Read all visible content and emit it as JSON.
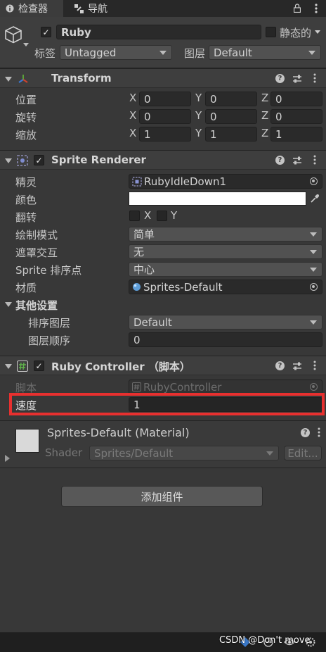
{
  "tabs": [
    {
      "label": "检查器",
      "icon": "info-icon"
    },
    {
      "label": "导航",
      "icon": "navigation-icon"
    }
  ],
  "header": {
    "name": "Ruby",
    "static_label": "静态的",
    "tag_label": "标签",
    "tag_value": "Untagged",
    "layer_label": "图层",
    "layer_value": "Default"
  },
  "transform": {
    "title": "Transform",
    "rows": [
      {
        "label": "位置",
        "x": "0",
        "y": "0",
        "z": "0"
      },
      {
        "label": "旋转",
        "x": "0",
        "y": "0",
        "z": "0"
      },
      {
        "label": "缩放",
        "x": "1",
        "y": "1",
        "z": "1"
      }
    ],
    "axes": [
      "X",
      "Y",
      "Z"
    ]
  },
  "sprite_renderer": {
    "title": "Sprite Renderer",
    "sprite_label": "精灵",
    "sprite_value": "RubyIdleDown1",
    "color_label": "颜色",
    "color_value": "#ffffff",
    "flip_label": "翻转",
    "flip_x": "X",
    "flip_y": "Y",
    "draw_mode_label": "绘制模式",
    "draw_mode_value": "简单",
    "mask_label": "遮罩交互",
    "mask_value": "无",
    "sort_point_label": "Sprite 排序点",
    "sort_point_value": "中心",
    "material_label": "材质",
    "material_value": "Sprites-Default",
    "other_settings_label": "其他设置",
    "sorting_layer_label": "排序图层",
    "sorting_layer_value": "Default",
    "order_label": "图层顺序",
    "order_value": "0"
  },
  "ruby_controller": {
    "title": "Ruby Controller （脚本）",
    "script_label": "脚本",
    "script_value": "RubyController",
    "speed_label": "速度",
    "speed_value": "1",
    "highlight_color": "#e8302f"
  },
  "material": {
    "title": "Sprites-Default (Material)",
    "shader_label": "Shader",
    "shader_value": "Sprites/Default",
    "edit_label": "Edit..."
  },
  "add_component_label": "添加组件",
  "watermark": "CSDN @Don't move"
}
